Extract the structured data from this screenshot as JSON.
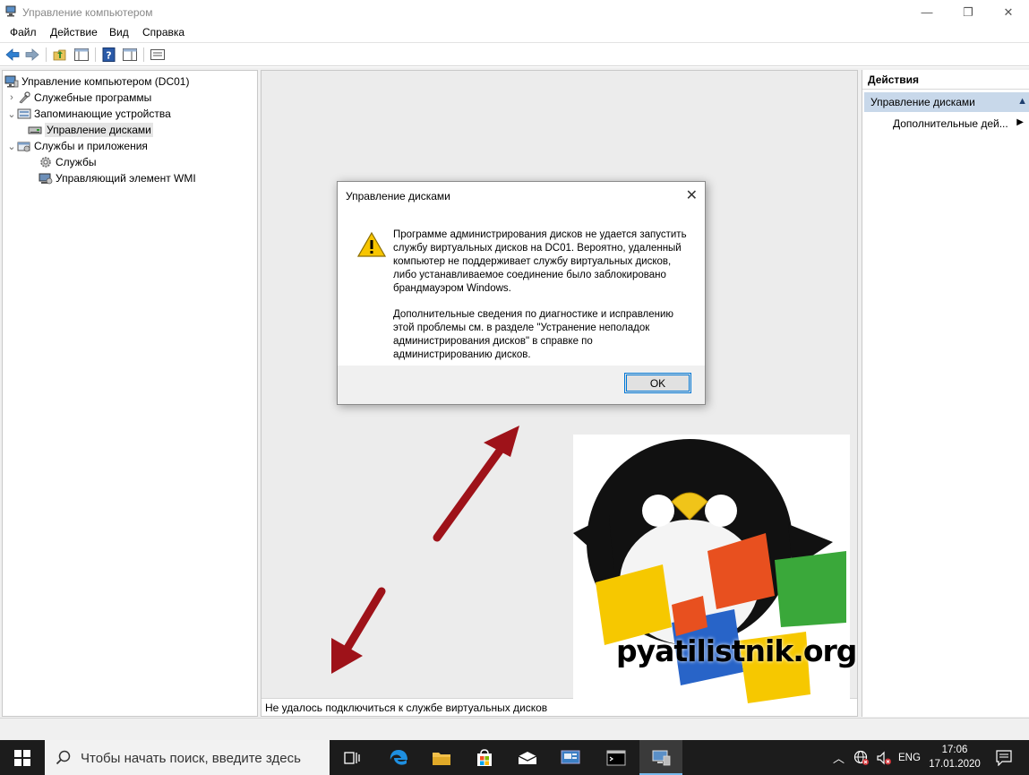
{
  "window": {
    "title": "Управление компьютером",
    "controls": {
      "minimize": "—",
      "restore": "❐",
      "close": "✕"
    }
  },
  "menu": {
    "items": [
      "Файл",
      "Действие",
      "Вид",
      "Справка"
    ]
  },
  "tree": {
    "root": "Управление компьютером (DC01)",
    "items": [
      {
        "label": "Служебные программы",
        "caret": "›"
      },
      {
        "label": "Запоминающие устройства",
        "caret": "⌄"
      },
      {
        "label": "Управление дисками"
      },
      {
        "label": "Службы и приложения",
        "caret": "⌄"
      },
      {
        "label": "Службы"
      },
      {
        "label": "Управляющий элемент WMI"
      }
    ]
  },
  "center": {
    "status_text": "Не удалось подключиться к службе виртуальных дисков"
  },
  "actions": {
    "header": "Действия",
    "section": "Управление дисками",
    "item": "Дополнительные дей..."
  },
  "dialog": {
    "title": "Управление дисками",
    "paragraph1": "Программе администрирования дисков не удается запустить службу виртуальных дисков на DC01. Вероятно, удаленный компьютер не поддерживает службу виртуальных дисков, либо устанавливаемое соединение было заблокировано брандмауэром Windows.",
    "paragraph2": "Дополнительные сведения по диагностике и исправлению этой проблемы см. в разделе \"Устранение неполадок администрирования дисков\" в справке по администрированию дисков.",
    "ok_label": "OK",
    "close_label": "✕"
  },
  "logo": {
    "text": "pyatilistnik.org"
  },
  "taskbar": {
    "search_placeholder": "Чтобы начать поиск, введите здесь",
    "language": "ENG",
    "time": "17:06",
    "date": "17.01.2020"
  },
  "colors": {
    "accent": "#0078d7",
    "taskbar": "#1c1c1c",
    "actions_highlight": "#c8d8ea",
    "arrow": "#b5121b"
  }
}
